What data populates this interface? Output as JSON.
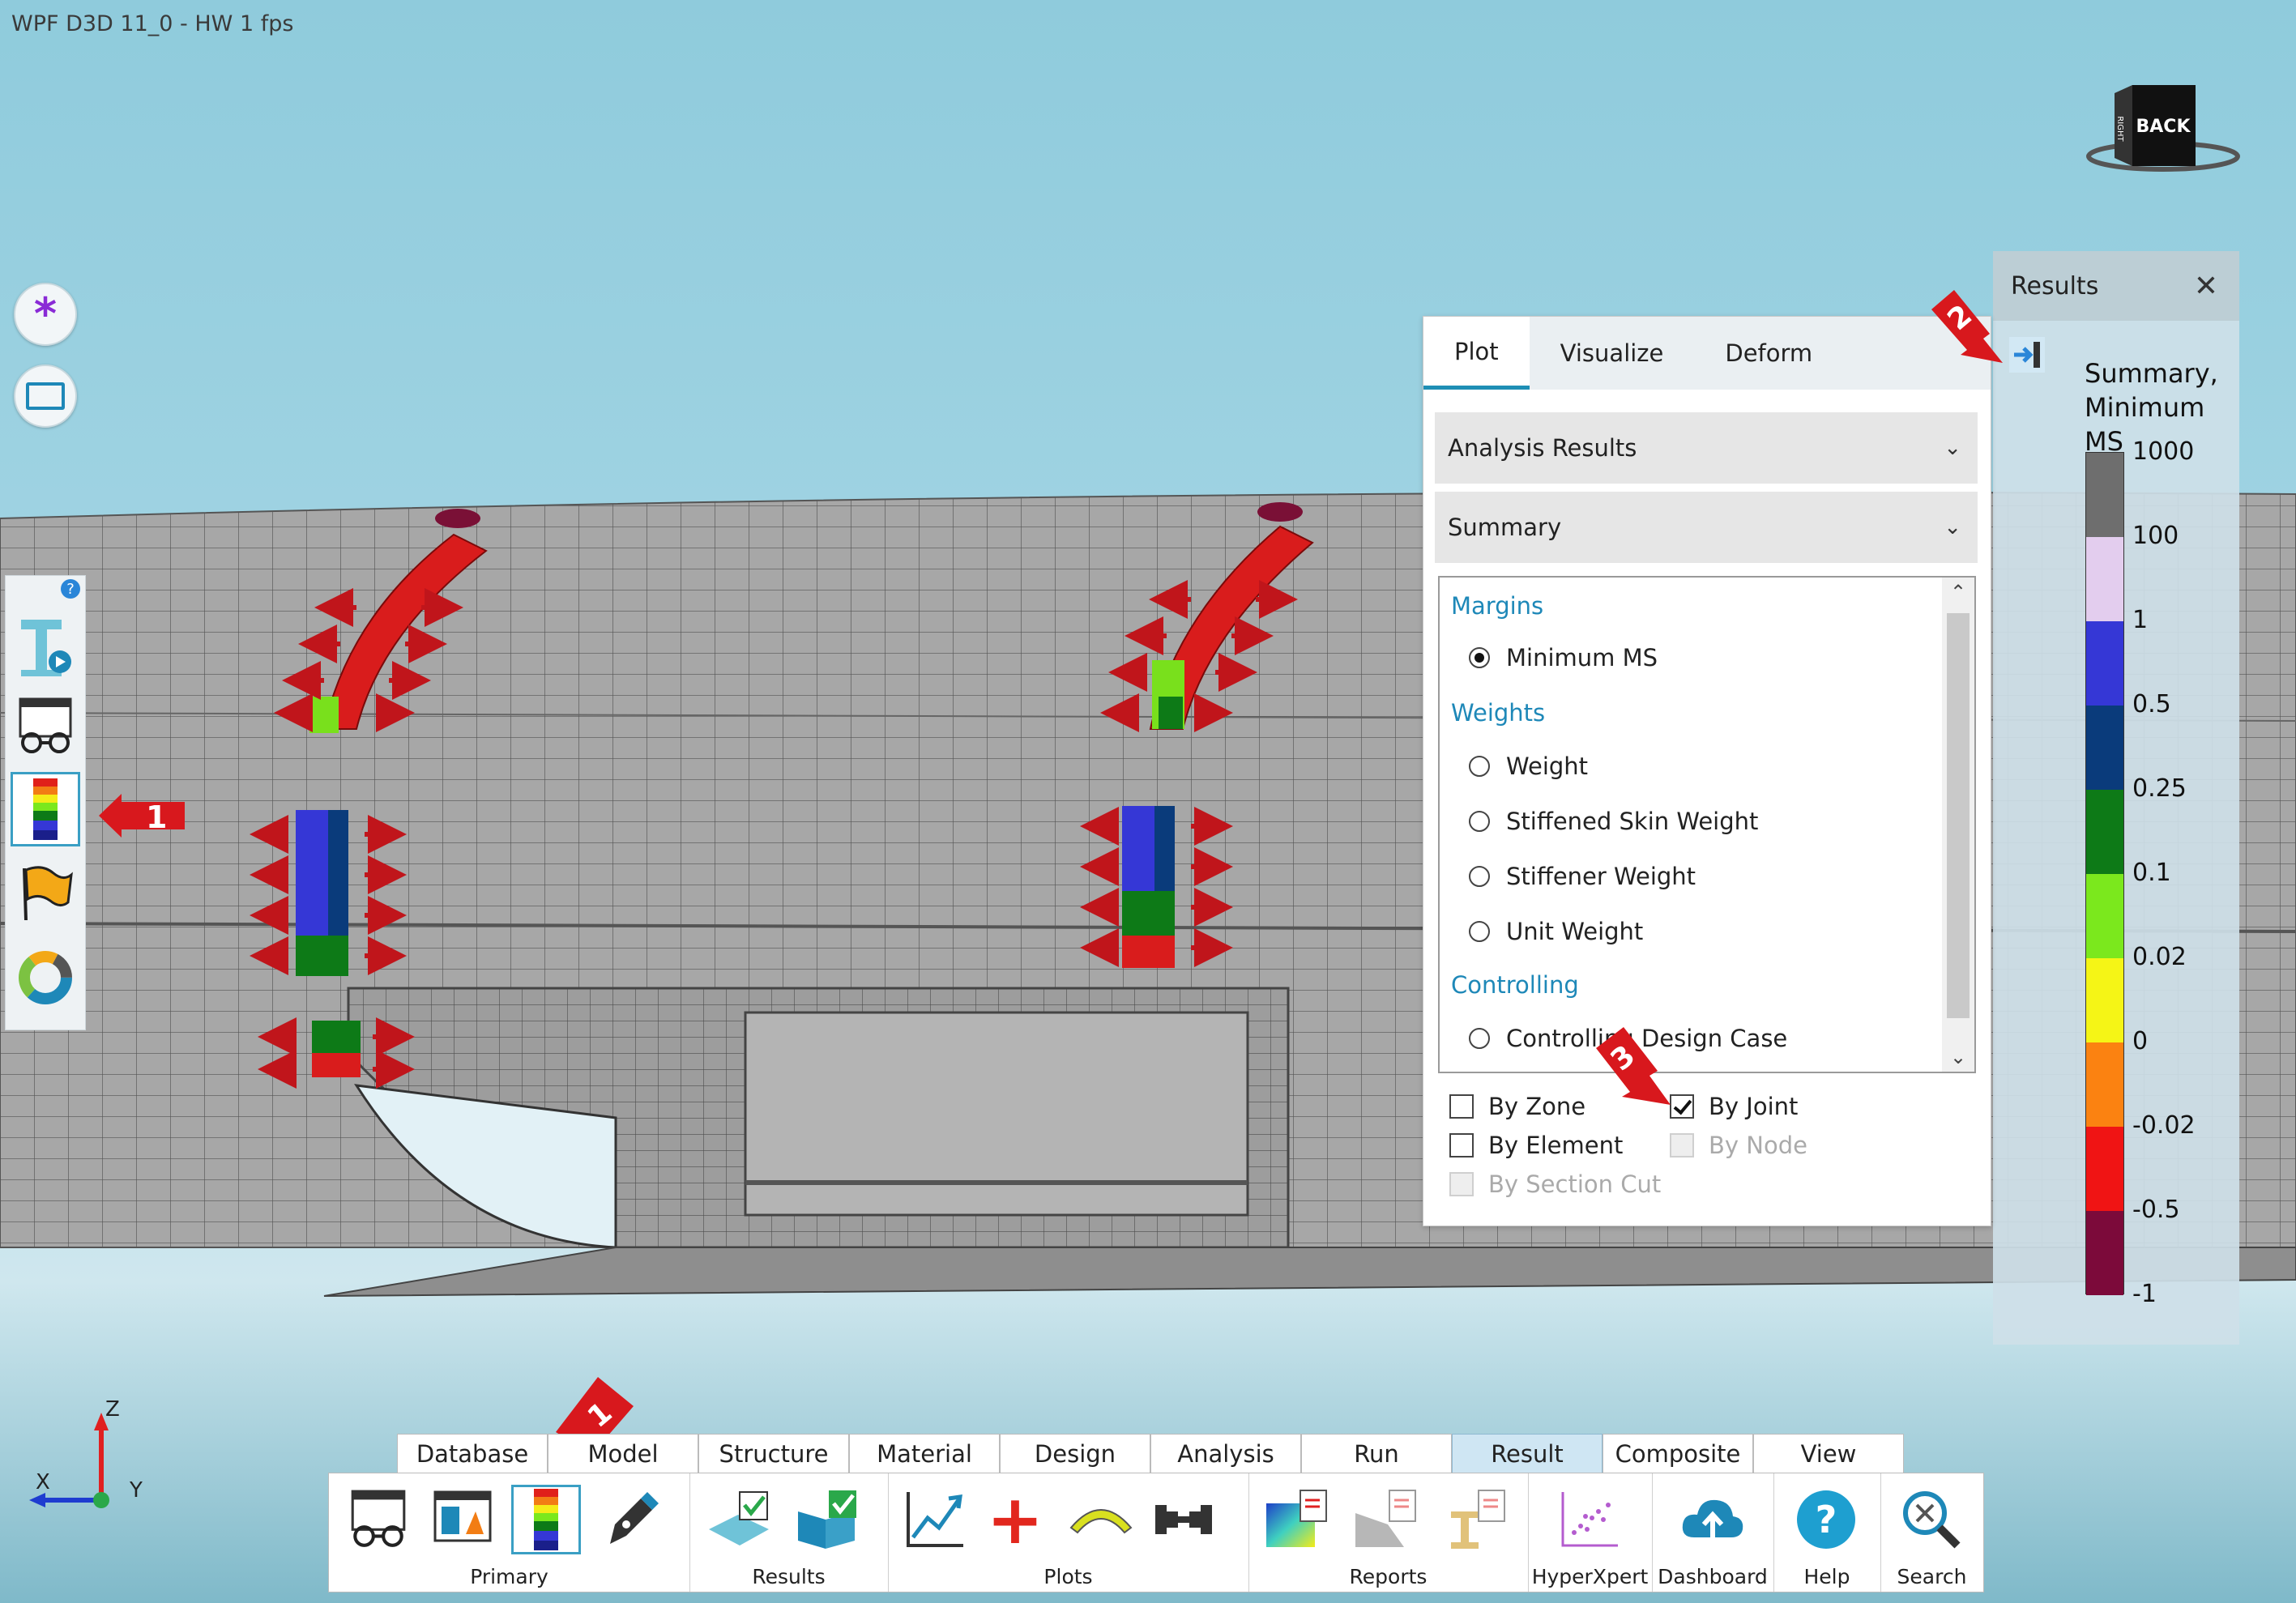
{
  "window": {
    "title": "WPF D3D 11_0 - HW  1 fps"
  },
  "nav_cube": {
    "face_top": "BACK",
    "face_side": "RIGHT"
  },
  "left_toolbar": {
    "help_badge": "?",
    "items": [
      "bolt-joint-tool-icon",
      "glasses-view-icon",
      "contour-legend-icon",
      "flag-icon",
      "donut-chart-icon"
    ]
  },
  "callouts": {
    "left": "1",
    "legend": "2",
    "by_joint": "3",
    "ribbon": "1"
  },
  "plot_panel": {
    "tabs": [
      {
        "label": "Plot",
        "active": true
      },
      {
        "label": "Visualize",
        "active": false
      },
      {
        "label": "Deform",
        "active": false
      }
    ],
    "dropdown_results": "Analysis Results",
    "dropdown_summary": "Summary",
    "groups": {
      "margins": "Margins",
      "weights": "Weights",
      "controlling": "Controlling"
    },
    "options": {
      "minimum_ms": "Minimum MS",
      "weight": "Weight",
      "stiffened_skin_weight": "Stiffened Skin Weight",
      "stiffener_weight": "Stiffener Weight",
      "unit_weight": "Unit Weight",
      "controlling_design_case": "Controlling Design Case"
    },
    "selected_option": "Minimum MS",
    "checkboxes": {
      "by_zone": {
        "label": "By Zone",
        "checked": false,
        "enabled": true
      },
      "by_joint": {
        "label": "By Joint",
        "checked": true,
        "enabled": true
      },
      "by_element": {
        "label": "By Element",
        "checked": false,
        "enabled": true
      },
      "by_node": {
        "label": "By Node",
        "checked": false,
        "enabled": false
      },
      "by_section_cut": {
        "label": "By Section Cut",
        "checked": false,
        "enabled": false
      }
    }
  },
  "results_panel": {
    "title": "Results",
    "legend_title_line1": "Summary,",
    "legend_title_line2": "Minimum MS",
    "legend_labels": [
      "1000",
      "100",
      "1",
      "0.5",
      "0.25",
      "0.1",
      "0.02",
      "0",
      "-0.02",
      "-0.5",
      "-1"
    ],
    "legend_colors": [
      "#6e6e6e",
      "#e3cdee",
      "#3537d6",
      "#0a3b7b",
      "#0d7a17",
      "#7be81d",
      "#f5f516",
      "#fb8211",
      "#f01414",
      "#7c0a3a"
    ]
  },
  "ribbon": {
    "tabs": [
      {
        "label": "Database",
        "active": false
      },
      {
        "label": "Model",
        "active": false
      },
      {
        "label": "Structure",
        "active": false
      },
      {
        "label": "Material",
        "active": false
      },
      {
        "label": "Design",
        "active": false
      },
      {
        "label": "Analysis",
        "active": false
      },
      {
        "label": "Run",
        "active": false
      },
      {
        "label": "Result",
        "active": true
      },
      {
        "label": "Composite",
        "active": false
      },
      {
        "label": "View",
        "active": false
      }
    ],
    "groups": {
      "primary": "Primary",
      "results": "Results",
      "plots": "Plots",
      "reports": "Reports",
      "hyperxpert": "HyperXpert",
      "dashboard": "Dashboard",
      "help": "Help",
      "search": "Search"
    }
  },
  "axis_triad": {
    "z": "Z",
    "x": "X",
    "y": "Y"
  }
}
